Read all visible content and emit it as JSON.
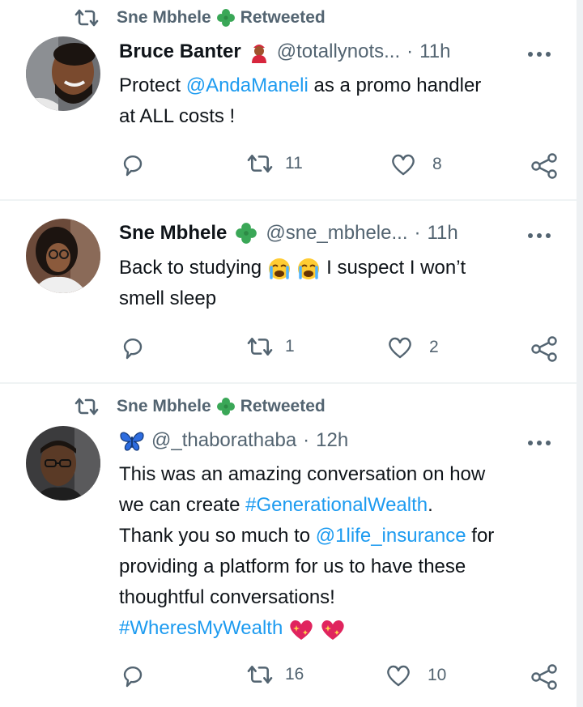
{
  "colors": {
    "text": "#0f1419",
    "muted": "#536471",
    "link": "#1d9bf0",
    "divider": "#eff3f4",
    "clover": "#3aa757"
  },
  "tweets": [
    {
      "retweet_by": "Sne Mbhele",
      "retweet_suffix": "Retweeted",
      "name": "Bruce Banter",
      "handle": "@totallynots...",
      "dot": "·",
      "time": "11h",
      "text": {
        "prefix": "Protect ",
        "mention": "@AndaManeli",
        "suffix": " as a promo handler",
        "line2": "at ALL costs !"
      },
      "stats": {
        "retweets": "11",
        "likes": "8"
      }
    },
    {
      "name": "Sne Mbhele",
      "handle": "@sne_mbhele...",
      "dot": "·",
      "time": "11h",
      "text": {
        "prefix": "Back to studying",
        "suffix": " I suspect I won’t",
        "line2": "smell sleep"
      },
      "stats": {
        "retweets": "1",
        "likes": "2"
      }
    },
    {
      "retweet_by": "Sne Mbhele",
      "retweet_suffix": "Retweeted",
      "handle": "@_thaborathaba",
      "dot": "·",
      "time": "12h",
      "text": {
        "line1": "This was an amazing conversation on how",
        "line2_prefix": "we can create ",
        "hashtag1": "#GenerationalWealth",
        "line2_suffix": ".",
        "line3_prefix": "Thank you so much to ",
        "mention": "@1life_insurance",
        "line3_suffix": " for",
        "line4": "providing a platform for us to have these",
        "line5": "thoughtful conversations!",
        "hashtag2": "#WheresMyWealth"
      },
      "stats": {
        "retweets": "16",
        "likes": "10"
      }
    }
  ]
}
